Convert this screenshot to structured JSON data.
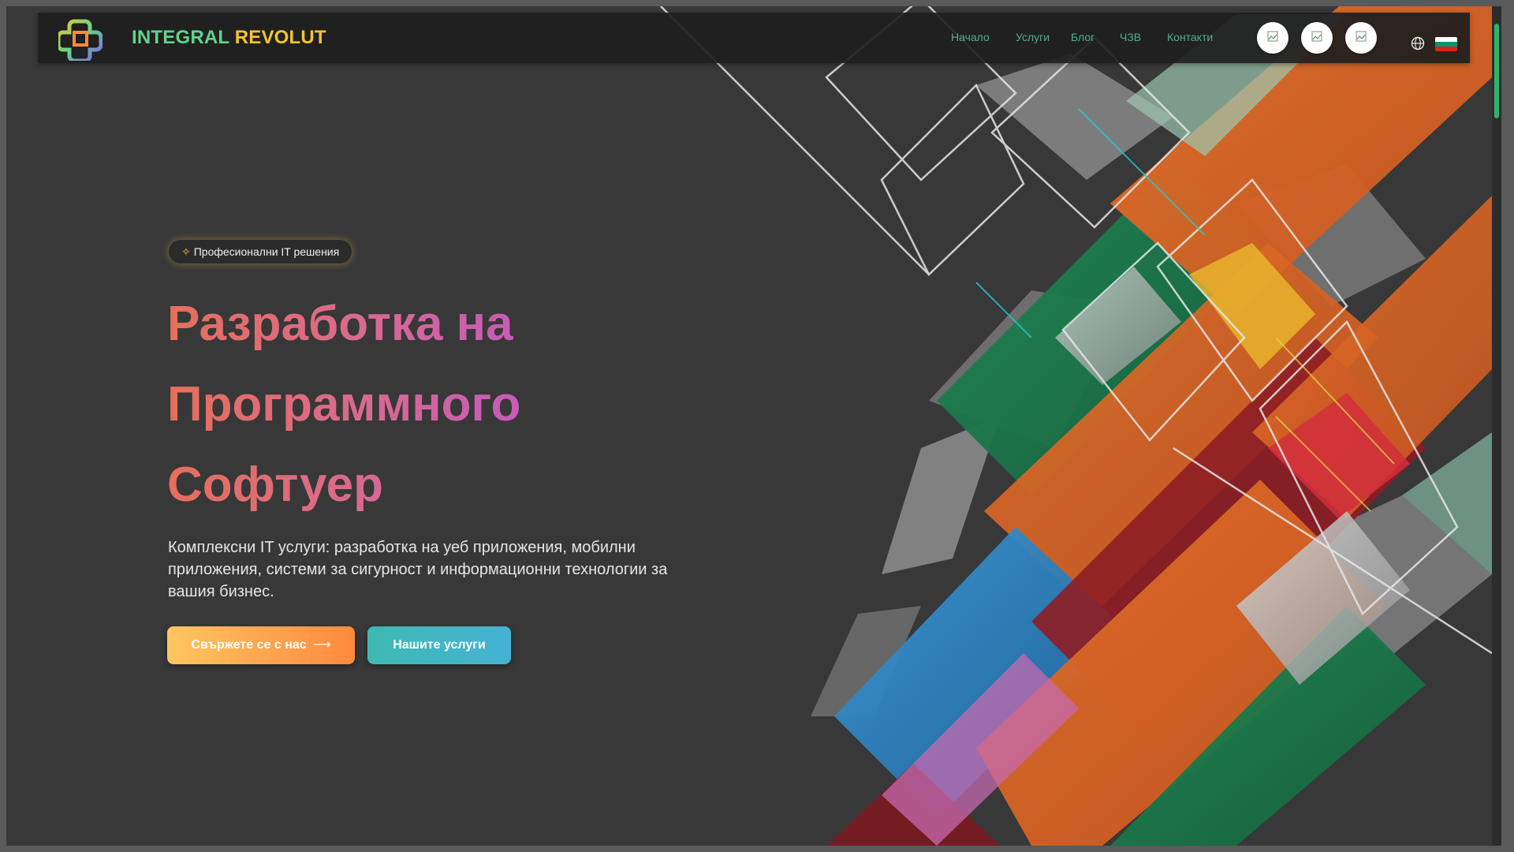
{
  "brand": {
    "part1": "INTEGRAL",
    "part2": "REVOLUT"
  },
  "nav": {
    "items": [
      {
        "label": "Начало"
      },
      {
        "label": "Услуги"
      },
      {
        "label": "Блог"
      },
      {
        "label": "ЧЗВ"
      },
      {
        "label": "Контакти"
      }
    ]
  },
  "header_actions": {
    "icon_buttons": [
      {
        "icon": "broken-image-icon"
      },
      {
        "icon": "broken-image-icon"
      },
      {
        "icon": "broken-image-icon"
      }
    ],
    "language_icon": "globe-icon",
    "language_flag": "flag-bulgaria-icon"
  },
  "hero": {
    "badge": "Професионални IT решения",
    "badge_icon": "sparkle-icon",
    "title_lines": [
      "Разработка на",
      "Программного",
      "Софтуер"
    ],
    "description": "Комплексни IT услуги: разработка на уеб приложения, мобилни приложения, системи за сигурност и информационни технологии за вашия бизнес.",
    "primary_button": "Свържете се с нас",
    "primary_button_arrow": "⟶",
    "secondary_button": "Нашите услуги"
  },
  "colors": {
    "background": "#383838",
    "header_bg": "#1e1e1e",
    "nav_link": "#4fb08a",
    "brand_green": "#5fd48b",
    "brand_yellow": "#f4c430",
    "title_gradient": [
      "#e66f5a",
      "#d96a8f",
      "#c257c2"
    ],
    "primary_button": [
      "#ffc660",
      "#ff8a3d"
    ],
    "secondary_button": [
      "#3eb9b2",
      "#45b2d4"
    ]
  }
}
